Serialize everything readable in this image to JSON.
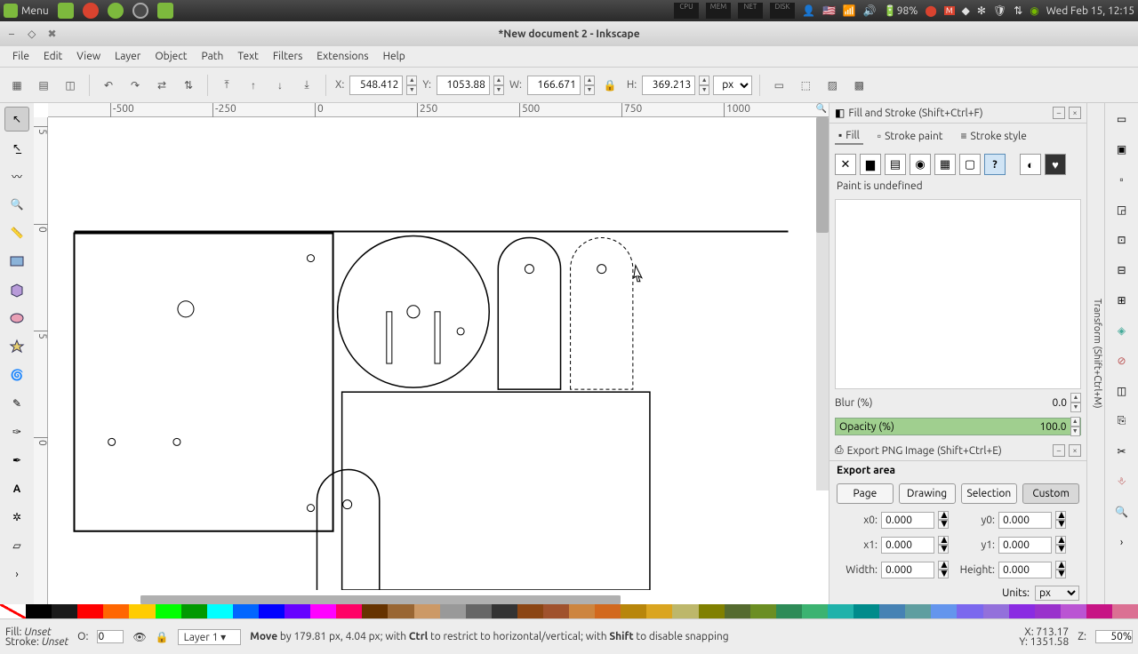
{
  "system": {
    "menu_label": "Menu",
    "indicators": {
      "cpu": "CPU",
      "mem": "MEM",
      "net": "NET",
      "disk": "DISK"
    },
    "battery": "98%",
    "clock": "Wed Feb 15, 12:15"
  },
  "window": {
    "title": "*New document 2 - Inkscape"
  },
  "menubar": [
    "File",
    "Edit",
    "View",
    "Layer",
    "Object",
    "Path",
    "Text",
    "Filters",
    "Extensions",
    "Help"
  ],
  "toolbar": {
    "x_label": "X:",
    "x_value": "548.412",
    "y_label": "Y:",
    "y_value": "1053.88",
    "w_label": "W:",
    "w_value": "166.671",
    "h_label": "H:",
    "h_value": "369.213",
    "unit": "px"
  },
  "ruler_h": [
    "-500",
    "-250",
    "0",
    "250",
    "500",
    "750",
    "1000"
  ],
  "fill_stroke": {
    "title": "Fill and Stroke (Shift+Ctrl+F)",
    "tabs": {
      "fill": "Fill",
      "stroke_paint": "Stroke paint",
      "stroke_style": "Stroke style"
    },
    "message": "Paint is undefined",
    "blur_label": "Blur (%)",
    "blur_value": "0.0",
    "opacity_label": "Opacity (%)",
    "opacity_value": "100.0"
  },
  "export": {
    "title": "Export PNG Image (Shift+Ctrl+E)",
    "area_label": "Export area",
    "buttons": {
      "page": "Page",
      "drawing": "Drawing",
      "selection": "Selection",
      "custom": "Custom"
    },
    "x0_label": "x0:",
    "x0": "0.000",
    "y0_label": "y0:",
    "y0": "0.000",
    "x1_label": "x1:",
    "x1": "0.000",
    "y1_label": "y1:",
    "y1": "0.000",
    "width_label": "Width:",
    "width": "0.000",
    "height_label": "Height:",
    "height": "0.000",
    "units_label": "Units:",
    "units": "px"
  },
  "dock_tab": "Transform (Shift+Ctrl+M)",
  "palette": [
    "#000000",
    "#1a1a1a",
    "#ff0000",
    "#ff6600",
    "#ffcc00",
    "#00ff00",
    "#009900",
    "#00ffff",
    "#0066ff",
    "#0000ff",
    "#6600ff",
    "#ff00ff",
    "#ff0066",
    "#663300",
    "#996633",
    "#cc9966",
    "#999999",
    "#666666",
    "#333333",
    "#8b4513",
    "#a0522d",
    "#cd853f",
    "#d2691e",
    "#b8860b",
    "#daa520",
    "#bdb76b",
    "#808000",
    "#556b2f",
    "#6b8e23",
    "#2e8b57",
    "#3cb371",
    "#20b2aa",
    "#008b8b",
    "#4682b4",
    "#5f9ea0",
    "#6495ed",
    "#7b68ee",
    "#9370db",
    "#8a2be2",
    "#9932cc",
    "#ba55d3",
    "#c71585",
    "#db7093"
  ],
  "status": {
    "fill_label": "Fill:",
    "fill_value": "Unset",
    "stroke_label": "Stroke:",
    "stroke_value": "Unset",
    "o_label": "O:",
    "o_value": "0",
    "layer": "Layer 1",
    "msg_prefix": "Move",
    "msg_body": " by 179.81 px, 4.04 px; with ",
    "msg_ctrl": "Ctrl",
    "msg_body2": " to restrict to horizontal/vertical; with ",
    "msg_shift": "Shift",
    "msg_body3": " to disable snapping",
    "coord_x": "X:   713.17",
    "coord_y": "Y: 1351.58",
    "zoom": "50%"
  }
}
